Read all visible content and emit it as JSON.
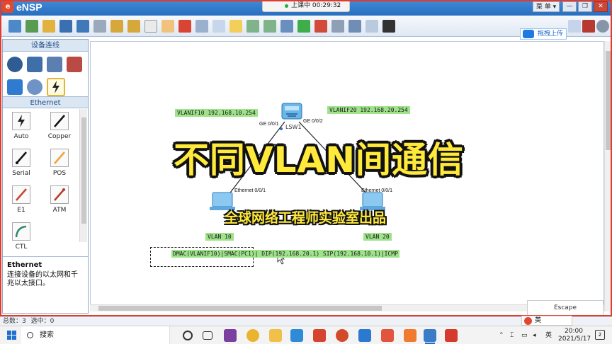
{
  "app": {
    "title": "eNSP",
    "logo": "e"
  },
  "recording": {
    "text": "上课中 00:29:32",
    "chevron": "⌄"
  },
  "window": {
    "menu_label": "菜 单",
    "menu_chevron": "▾",
    "minimize": "—",
    "restore": "❐",
    "close": "✕"
  },
  "upload_button": {
    "label": "拖拽上传"
  },
  "left_panel": {
    "header": "设备连线",
    "ethernet_tab": "Ethernet",
    "cables": [
      {
        "label": "Auto"
      },
      {
        "label": "Copper"
      },
      {
        "label": "Serial"
      },
      {
        "label": "POS"
      },
      {
        "label": "E1"
      },
      {
        "label": "ATM"
      },
      {
        "label": "CTL"
      }
    ],
    "info_title": "Ethernet",
    "info_text": "连接设备的以太网和千兆以太接口。"
  },
  "topology": {
    "switch_name": "LSW1",
    "labels": {
      "vlanif10": "VLANIF10   192.168.10.254",
      "vlanif20": "VLANIF20 192.168.20.254",
      "vlan10": "VLAN 10",
      "vlan20": "VLAN 20"
    },
    "ports": {
      "ge001": "GE 0/0/1",
      "ge002": "GE 0/0/2",
      "eth_left": "Ethernet 0/0/1",
      "eth_right": "Ethernet 0/0/1"
    },
    "frame_text": "DMAC(VLANIF10)|SMAC(PC1)| DIP(192.168.20.1) SIP(192.168.10.1)|ICMP",
    "overlay_title": "不同VLAN间通信",
    "overlay_subtitle": "全球网络工程师实验室出品"
  },
  "escape_label": "Escape",
  "statusbar": {
    "total": "总数：3",
    "selected": "选中：0"
  },
  "taskbar": {
    "search_placeholder": "搜索",
    "tray_lang": "英",
    "tray_ime": "英",
    "clock_time": "20:00",
    "clock_date": "2021/5/17",
    "notif_count": "2"
  },
  "colors": {
    "accent": "#2a6fc0",
    "label_green": "#9ee28a",
    "title_yellow": "#ffe93a",
    "frame_red": "#e23b2e"
  }
}
